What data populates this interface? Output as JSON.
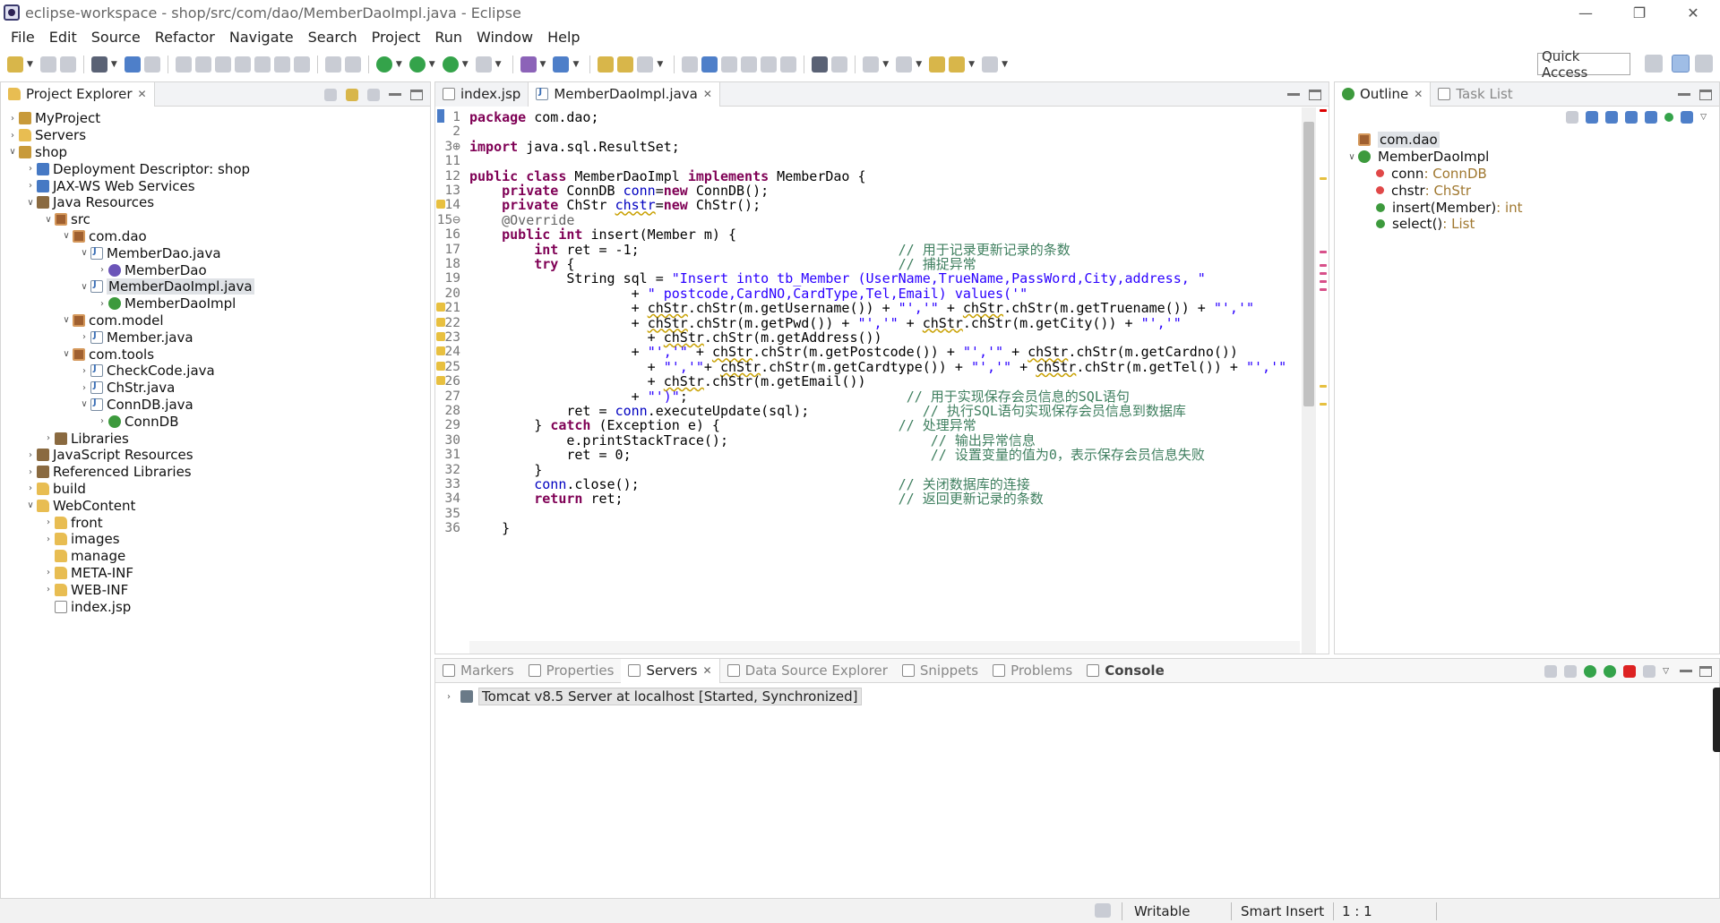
{
  "window": {
    "title": "eclipse-workspace - shop/src/com/dao/MemberDaoImpl.java - Eclipse",
    "controls": [
      "—",
      "❐",
      "✕"
    ]
  },
  "menu": [
    "File",
    "Edit",
    "Source",
    "Refactor",
    "Navigate",
    "Search",
    "Project",
    "Run",
    "Window",
    "Help"
  ],
  "toolbar": {
    "quick_access": "Quick Access"
  },
  "project_explorer": {
    "title": "Project Explorer",
    "tree": [
      {
        "depth": 0,
        "twist": "›",
        "icon": "proj",
        "label": "MyProject"
      },
      {
        "depth": 0,
        "twist": "›",
        "icon": "folder",
        "label": "Servers"
      },
      {
        "depth": 0,
        "twist": "∨",
        "icon": "proj",
        "label": "shop"
      },
      {
        "depth": 1,
        "twist": "›",
        "icon": "web",
        "label": "Deployment Descriptor: shop"
      },
      {
        "depth": 1,
        "twist": "›",
        "icon": "web",
        "label": "JAX-WS Web Services"
      },
      {
        "depth": 1,
        "twist": "∨",
        "icon": "lib",
        "label": "Java Resources"
      },
      {
        "depth": 2,
        "twist": "∨",
        "icon": "pkg",
        "label": "src"
      },
      {
        "depth": 3,
        "twist": "∨",
        "icon": "pkg",
        "label": "com.dao"
      },
      {
        "depth": 4,
        "twist": "∨",
        "icon": "java",
        "label": "MemberDao.java"
      },
      {
        "depth": 5,
        "twist": "›",
        "icon": "intf",
        "label": "MemberDao"
      },
      {
        "depth": 4,
        "twist": "∨",
        "icon": "java",
        "label": "MemberDaoImpl.java",
        "selected": true
      },
      {
        "depth": 5,
        "twist": "›",
        "icon": "cls",
        "label": "MemberDaoImpl"
      },
      {
        "depth": 3,
        "twist": "∨",
        "icon": "pkg",
        "label": "com.model"
      },
      {
        "depth": 4,
        "twist": "›",
        "icon": "java",
        "label": "Member.java"
      },
      {
        "depth": 3,
        "twist": "∨",
        "icon": "pkg",
        "label": "com.tools"
      },
      {
        "depth": 4,
        "twist": "›",
        "icon": "java",
        "label": "CheckCode.java"
      },
      {
        "depth": 4,
        "twist": "›",
        "icon": "java",
        "label": "ChStr.java"
      },
      {
        "depth": 4,
        "twist": "∨",
        "icon": "java",
        "label": "ConnDB.java"
      },
      {
        "depth": 5,
        "twist": "›",
        "icon": "cls",
        "label": "ConnDB"
      },
      {
        "depth": 2,
        "twist": "›",
        "icon": "lib",
        "label": "Libraries"
      },
      {
        "depth": 1,
        "twist": "›",
        "icon": "lib",
        "label": "JavaScript Resources"
      },
      {
        "depth": 1,
        "twist": "›",
        "icon": "lib",
        "label": "Referenced Libraries"
      },
      {
        "depth": 1,
        "twist": "›",
        "icon": "folder",
        "label": "build"
      },
      {
        "depth": 1,
        "twist": "∨",
        "icon": "folder",
        "label": "WebContent"
      },
      {
        "depth": 2,
        "twist": "›",
        "icon": "folder",
        "label": "front"
      },
      {
        "depth": 2,
        "twist": "›",
        "icon": "folder",
        "label": "images"
      },
      {
        "depth": 2,
        "twist": "",
        "icon": "folder",
        "label": "manage"
      },
      {
        "depth": 2,
        "twist": "›",
        "icon": "folder",
        "label": "META-INF"
      },
      {
        "depth": 2,
        "twist": "›",
        "icon": "folder",
        "label": "WEB-INF"
      },
      {
        "depth": 2,
        "twist": "",
        "icon": "jsp",
        "label": "index.jsp"
      }
    ]
  },
  "editor": {
    "tabs": [
      {
        "label": "index.jsp",
        "active": false
      },
      {
        "label": "MemberDaoImpl.java",
        "active": true
      }
    ],
    "lines": [
      {
        "n": "1",
        "html": "<span class=\"kw\">package</span> com.dao;"
      },
      {
        "n": "2",
        "html": ""
      },
      {
        "n": "3⊕",
        "html": "<span class=\"kw\">import</span> java.sql.ResultSet;"
      },
      {
        "n": "11",
        "html": ""
      },
      {
        "n": "12",
        "html": "<span class=\"kw\">public class</span> MemberDaoImpl <span class=\"kw\">implements</span> MemberDao {"
      },
      {
        "n": "13",
        "html": "    <span class=\"kw\">private</span> ConnDB <span class=\"fld\">conn</span>=<span class=\"kw\">new</span> ConnDB();"
      },
      {
        "n": "14",
        "html": "    <span class=\"kw\">private</span> ChStr <span class=\"fld warn\">chstr</span>=<span class=\"kw\">new</span> ChStr();"
      },
      {
        "n": "15⊖",
        "html": "    <span class=\"ann\">@Override</span>"
      },
      {
        "n": "16",
        "html": "    <span class=\"kw\">public int</span> insert(Member m) {"
      },
      {
        "n": "17",
        "html": "        <span class=\"kw\">int</span> ret = -1;                                <span class=\"cmt\">// 用于记录更新记录的条数</span>"
      },
      {
        "n": "18",
        "html": "        <span class=\"kw\">try</span> {                                        <span class=\"cmt\">// 捕捉异常</span>"
      },
      {
        "n": "19",
        "html": "            String sql = <span class=\"str\">\"Insert into tb_Member (UserName,TrueName,PassWord,City,address, \"</span>"
      },
      {
        "n": "20",
        "html": "                    + <span class=\"str\">\" postcode,CardNO,CardType,Tel,Email) values('\"</span>"
      },
      {
        "n": "21",
        "html": "                    + <span class=\"warn\">chStr</span>.chStr(m.getUsername()) + <span class=\"str\">\"','\"</span> + <span class=\"warn\">chStr</span>.chStr(m.getTruename()) + <span class=\"str\">\"','\"</span>"
      },
      {
        "n": "22",
        "html": "                    + <span class=\"warn\">chStr</span>.chStr(m.getPwd()) + <span class=\"str\">\"','\"</span> + <span class=\"warn\">chStr</span>.chStr(m.getCity()) + <span class=\"str\">\"','\"</span>"
      },
      {
        "n": "23",
        "html": "                      + <span class=\"warn\">chStr</span>.chStr(m.getAddress())"
      },
      {
        "n": "24",
        "html": "                    + <span class=\"str\">\"','\"</span> + <span class=\"warn\">chStr</span>.chStr(m.getPostcode()) + <span class=\"str\">\"','\"</span> + <span class=\"warn\">chStr</span>.chStr(m.getCardno())"
      },
      {
        "n": "25",
        "html": "                      + <span class=\"str\">\"','\"</span>+ <span class=\"warn\">chStr</span>.chStr(m.getCardtype()) + <span class=\"str\">\"','\"</span> + <span class=\"warn\">chStr</span>.chStr(m.getTel()) + <span class=\"str\">\"','\"</span>"
      },
      {
        "n": "26",
        "html": "                      + <span class=\"warn\">chStr</span>.chStr(m.getEmail())"
      },
      {
        "n": "27",
        "html": "                    + <span class=\"str\">\"')\"</span>;                           <span class=\"cmt\">// 用于实现保存会员信息的SQL语句</span>"
      },
      {
        "n": "28",
        "html": "            ret = <span class=\"fld\">conn</span>.executeUpdate(sql);              <span class=\"cmt\">// 执行SQL语句实现保存会员信息到数据库</span>"
      },
      {
        "n": "29",
        "html": "        } <span class=\"kw\">catch</span> (Exception e) {                      <span class=\"cmt\">// 处理异常</span>"
      },
      {
        "n": "30",
        "html": "            e.printStackTrace();                         <span class=\"cmt\">// 输出异常信息</span>"
      },
      {
        "n": "31",
        "html": "            ret = 0;                                     <span class=\"cmt\">// 设置变量的值为0，表示保存会员信息失败</span>"
      },
      {
        "n": "32",
        "html": "        }"
      },
      {
        "n": "33",
        "html": "        <span class=\"fld\">conn</span>.close();                                <span class=\"cmt\">// 关闭数据库的连接</span>"
      },
      {
        "n": "34",
        "html": "        <span class=\"kw\">return</span> ret;                                  <span class=\"cmt\">// 返回更新记录的条数</span>"
      },
      {
        "n": "35",
        "html": ""
      },
      {
        "n": "36",
        "html": "    }"
      }
    ]
  },
  "outline": {
    "tabs": [
      "Outline",
      "Task List"
    ],
    "items": [
      {
        "depth": 0,
        "twist": "",
        "icon": "pkg",
        "label": "com.dao",
        "type": "",
        "selected": true
      },
      {
        "depth": 0,
        "twist": "∨",
        "icon": "cls",
        "label": "MemberDaoImpl",
        "type": ""
      },
      {
        "depth": 1,
        "twist": "",
        "icon": "field",
        "label": "conn",
        "type": " : ConnDB"
      },
      {
        "depth": 1,
        "twist": "",
        "icon": "field",
        "label": "chstr",
        "type": " : ChStr"
      },
      {
        "depth": 1,
        "twist": "",
        "icon": "method",
        "label": "insert(Member)",
        "type": " : int"
      },
      {
        "depth": 1,
        "twist": "",
        "icon": "method",
        "label": "select()",
        "type": " : List"
      }
    ]
  },
  "bottom": {
    "tabs": [
      {
        "label": "Markers",
        "active": false
      },
      {
        "label": "Properties",
        "active": false
      },
      {
        "label": "Servers",
        "active": true
      },
      {
        "label": "Data Source Explorer",
        "active": false
      },
      {
        "label": "Snippets",
        "active": false
      },
      {
        "label": "Problems",
        "active": false
      },
      {
        "label": "Console",
        "active": false
      }
    ],
    "server": "Tomcat v8.5 Server at localhost  [Started, Synchronized]"
  },
  "status": {
    "writable": "Writable",
    "insert_mode": "Smart Insert",
    "position": "1 : 1"
  },
  "colors": {
    "keyword": "#7f0055",
    "string": "#2a00ff",
    "comment": "#3f7f5f",
    "field": "#0000c0"
  }
}
